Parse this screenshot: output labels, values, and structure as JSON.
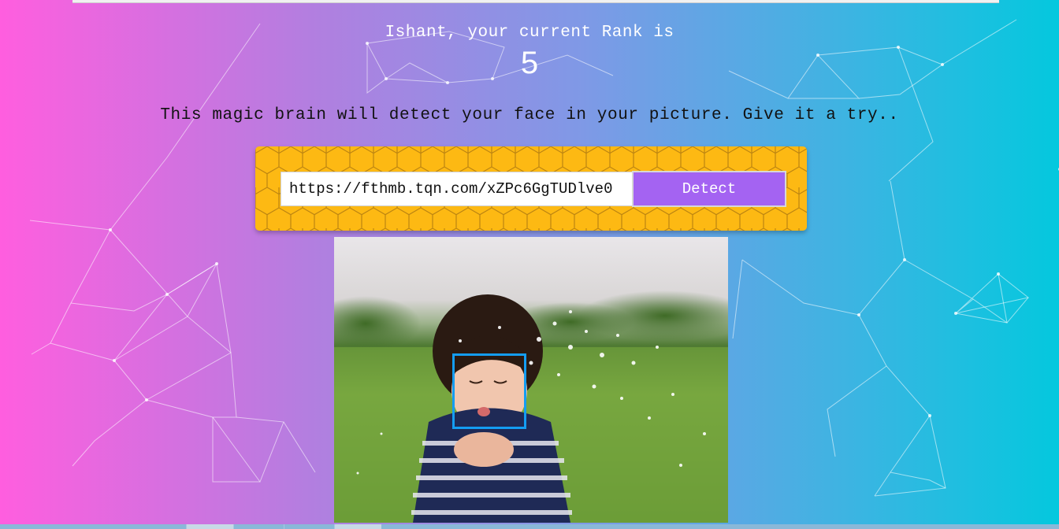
{
  "header": {
    "greeting": "Ishant, your current Rank is",
    "rank": "5"
  },
  "tagline": "This magic brain will detect your face in your picture. Give it a try..",
  "form": {
    "url_value": "https://fthmb.tqn.com/xZPc6GgTUDlve0",
    "detect_label": "Detect"
  },
  "result": {
    "image_subject": "child blowing dandelion seeds in a field",
    "face_box_color": "#149df2"
  },
  "colors": {
    "gradient_left": "#ff5edf",
    "gradient_right": "#04c8de",
    "panel": "#fdb913",
    "button": "#a463f2"
  }
}
